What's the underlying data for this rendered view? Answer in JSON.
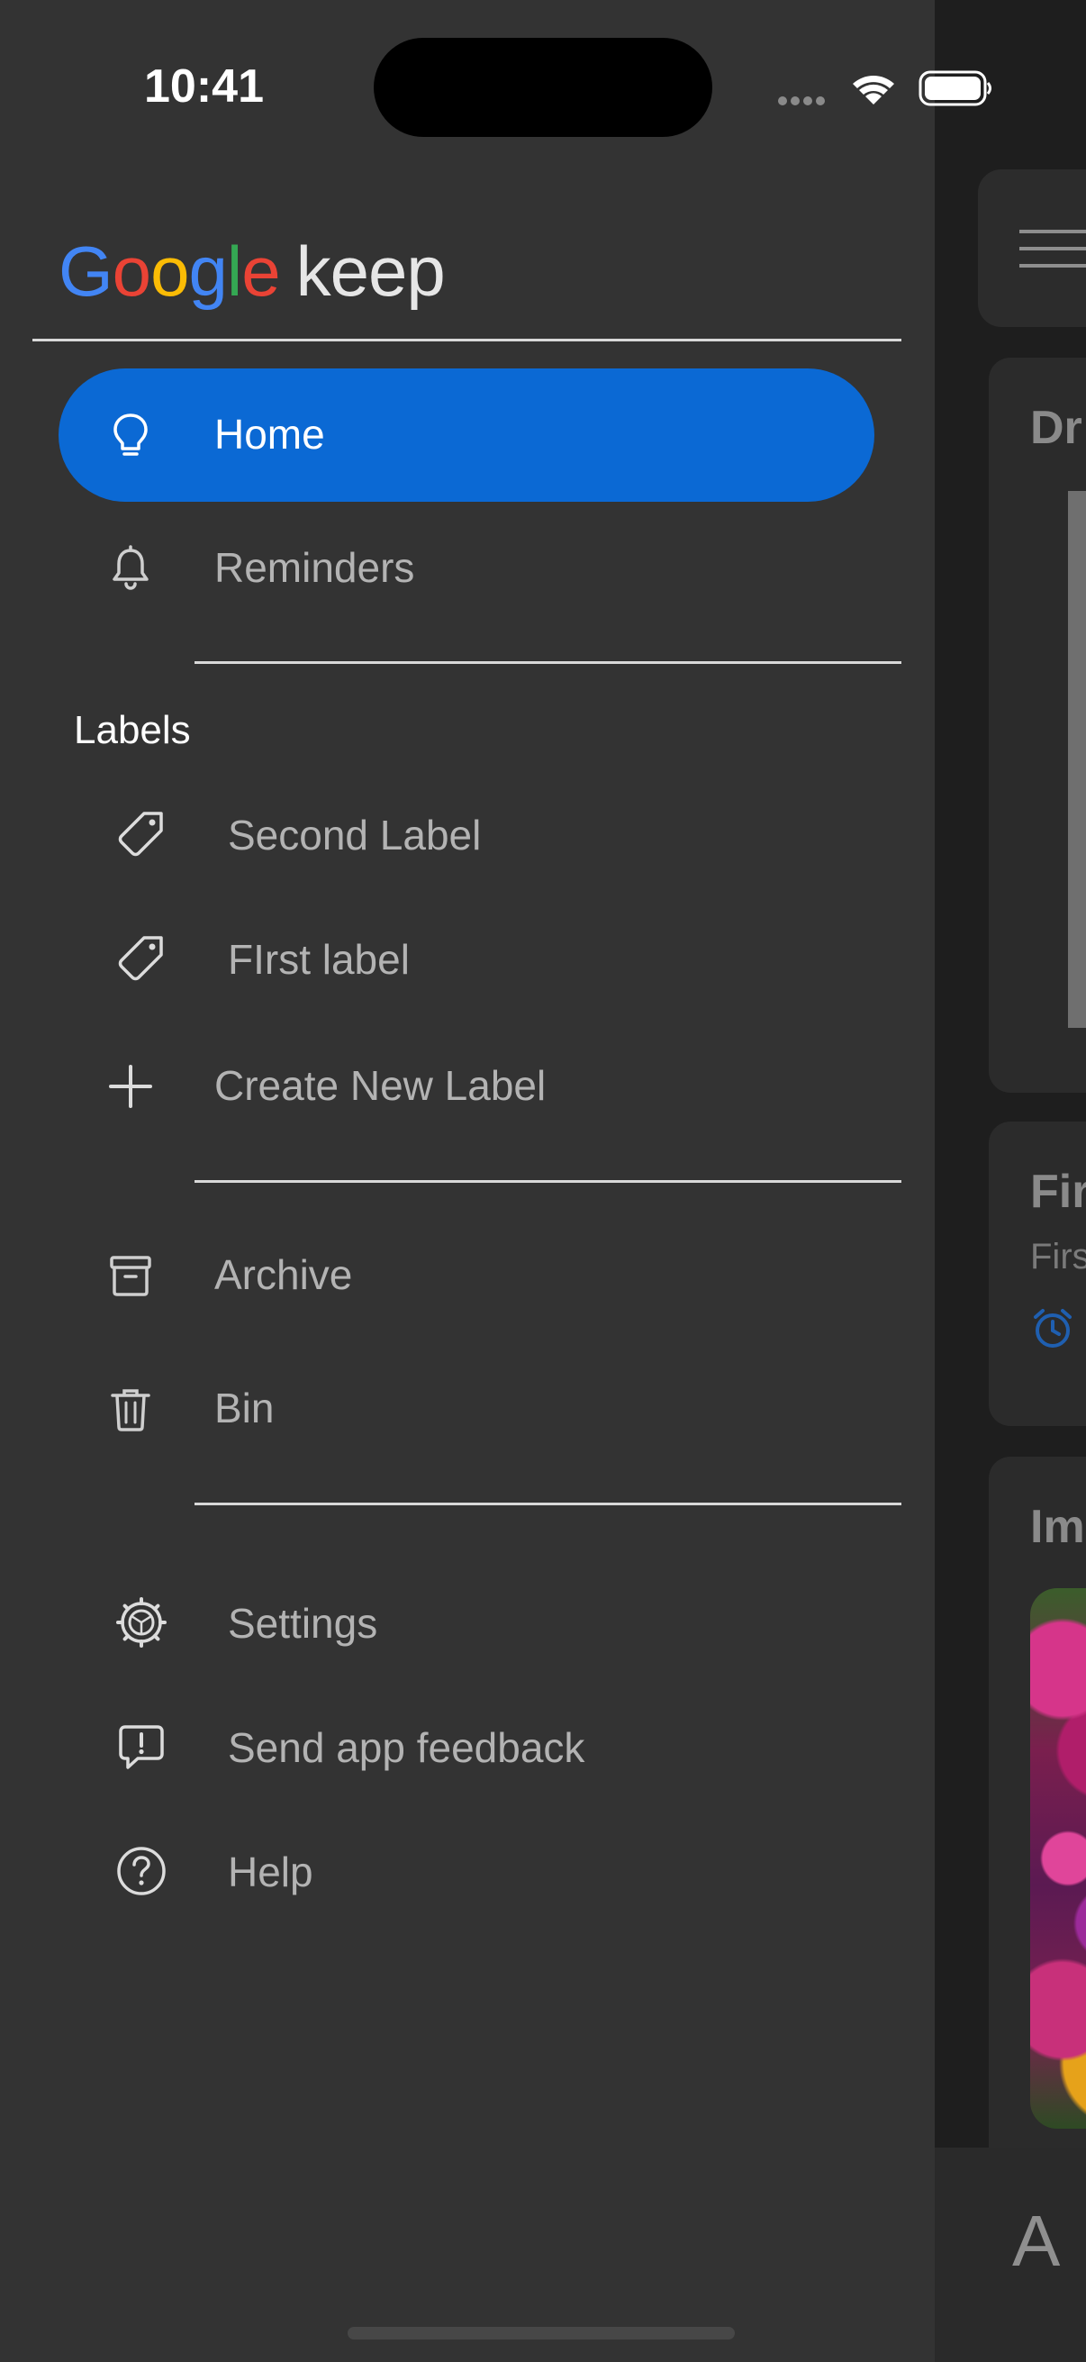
{
  "status_bar": {
    "time": "10:41"
  },
  "drawer": {
    "logo": {
      "google_letters": [
        {
          "char": "G",
          "color": "#4285f4"
        },
        {
          "char": "o",
          "color": "#ea4335"
        },
        {
          "char": "o",
          "color": "#fbbc05"
        },
        {
          "char": "g",
          "color": "#4285f4"
        },
        {
          "char": "l",
          "color": "#34a853"
        },
        {
          "char": "e",
          "color": "#ea4335"
        }
      ],
      "product": "keep"
    },
    "primary": [
      {
        "label": "Home",
        "icon": "lightbulb-icon",
        "active": true
      },
      {
        "label": "Reminders",
        "icon": "bell-icon",
        "active": false
      }
    ],
    "labels_heading": "Labels",
    "labels": [
      {
        "label": "Second Label",
        "icon": "tag-icon"
      },
      {
        "label": "FIrst label",
        "icon": "tag-icon"
      }
    ],
    "create_label": {
      "label": "Create New Label",
      "icon": "plus-icon"
    },
    "secondary": [
      {
        "label": "Archive",
        "icon": "archive-icon"
      },
      {
        "label": "Bin",
        "icon": "trash-icon"
      }
    ],
    "footer": [
      {
        "label": "Settings",
        "icon": "gear-icon"
      },
      {
        "label": "Send app feedback",
        "icon": "feedback-icon"
      },
      {
        "label": "Help",
        "icon": "help-icon"
      }
    ],
    "active_color": "#0b69d4"
  },
  "main": {
    "notes": [
      {
        "title_visible": "Dr"
      },
      {
        "title_visible": "Fir",
        "subtitle_visible": "Firs"
      },
      {
        "title_visible": "Im"
      }
    ],
    "bottom_bar_glyph": "A"
  }
}
